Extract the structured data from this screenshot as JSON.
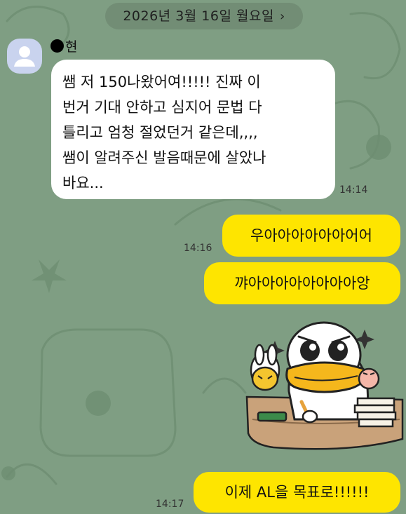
{
  "date_header": {
    "label": "2026년 3월 16일 월요일",
    "chevron": "›"
  },
  "incoming": {
    "sender_suffix": "현",
    "lines": [
      "쌤 저 150나왔어여!!!!! 진짜 이",
      "번거 기대 안하고 심지어 문법 다",
      "틀리고 엄청 절었던거 같은데,,,,",
      "쌤이 알려주신 발음때문에 살았나",
      "바요..."
    ],
    "time": "14:14"
  },
  "outgoing": [
    {
      "text": "우아아아아아아어어",
      "time": "14:16"
    },
    {
      "text": "꺄아아아아아아아아앙",
      "time": ""
    },
    {
      "text": "이제 AL을 목표로!!!!!!",
      "time": "14:17"
    }
  ],
  "sticker": {
    "icon": "studying-duck-character-sticker"
  },
  "colors": {
    "background": "#7f9e83",
    "outgoing_bubble": "#fee500",
    "incoming_bubble": "#ffffff",
    "avatar": "#c9d3ee"
  }
}
